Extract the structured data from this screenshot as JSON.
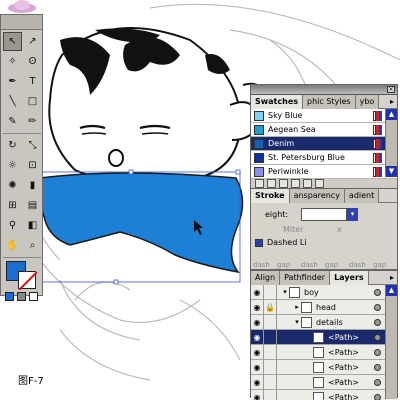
{
  "swatches": {
    "tabs": [
      "Swatches",
      "phic Styles",
      "ybo"
    ],
    "items": [
      {
        "name": "Sky Blue",
        "color": "#7fd3ef",
        "selected": false
      },
      {
        "name": "Aegean Sea",
        "color": "#1e9ed0",
        "selected": false
      },
      {
        "name": "Denim",
        "color": "#1463b3",
        "selected": true
      },
      {
        "name": "St. Petersburg Blue",
        "color": "#0b2fa5",
        "selected": false
      },
      {
        "name": "Periwinkle",
        "color": "#8a8ef0",
        "selected": false
      }
    ]
  },
  "stroke": {
    "tabs": [
      "Stroke",
      "ansparency",
      "adient"
    ],
    "weight_label": "eight:",
    "miter_label": "Miter",
    "miter_unit": "x",
    "dashed_label": "Dashed Li",
    "dash_labels": [
      "dash",
      "gap",
      "dash",
      "gap",
      "dash",
      "gap"
    ]
  },
  "layers": {
    "tabs": [
      "Align",
      "Pathfinder",
      "Layers"
    ],
    "rows": [
      {
        "name": "boy",
        "level": 0,
        "selected": false
      },
      {
        "name": "head",
        "level": 1,
        "selected": false
      },
      {
        "name": "details",
        "level": 1,
        "selected": false
      },
      {
        "name": "<Path>",
        "level": 2,
        "selected": true
      },
      {
        "name": "<Path>",
        "level": 2,
        "selected": false
      },
      {
        "name": "<Path>",
        "level": 2,
        "selected": false
      },
      {
        "name": "<Path>",
        "level": 2,
        "selected": false
      },
      {
        "name": "<Path>",
        "level": 2,
        "selected": false
      }
    ]
  },
  "toolbox": {
    "fill_color": "#1a6ed0",
    "stroke_color": "none"
  },
  "caption": "图F-7"
}
